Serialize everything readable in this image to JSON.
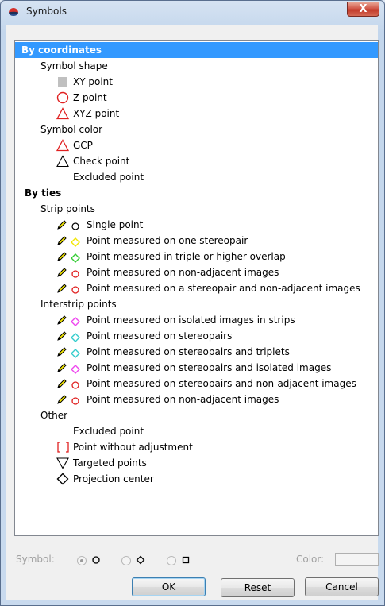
{
  "window": {
    "title": "Symbols",
    "close_label": "X"
  },
  "tree": {
    "by_coordinates": {
      "label": "By coordinates",
      "symbol_shape_label": "Symbol shape",
      "xy_point": "XY point",
      "z_point": "Z point",
      "xyz_point": "XYZ point",
      "symbol_color_label": "Symbol color",
      "gcp": "GCP",
      "check_point": "Check point",
      "excluded_point": "Excluded point"
    },
    "by_ties": {
      "label": "By ties",
      "strip_points_label": "Strip points",
      "strip_items": [
        "Single point",
        "Point measured on one stereopair",
        "Point measured in triple or higher overlap",
        "Point measured on non-adjacent images",
        "Point measured on a stereopair and non-adjacent images"
      ],
      "interstrip_points_label": "Interstrip points",
      "interstrip_items": [
        "Point measured on isolated images in strips",
        "Point measured on stereopairs",
        "Point measured on stereopairs and triplets",
        "Point measured on stereopairs and isolated images",
        "Point measured on stereopairs and non-adjacent images",
        "Point measured on non-adjacent images"
      ],
      "other_label": "Other",
      "other_excluded": "Excluded point",
      "without_adjustment": "Point without adjustment",
      "targeted_points": "Targeted points",
      "projection_center": "Projection center"
    }
  },
  "bottom": {
    "symbol_label": "Symbol:",
    "color_label": "Color:"
  },
  "buttons": {
    "ok": "OK",
    "reset": "Reset",
    "cancel": "Cancel"
  },
  "colors": {
    "selection": "#3399ff",
    "red": "#e02020",
    "yellow": "#f2e600",
    "green": "#33cc33",
    "magenta": "#ee44ee",
    "cyan": "#33cccc"
  }
}
